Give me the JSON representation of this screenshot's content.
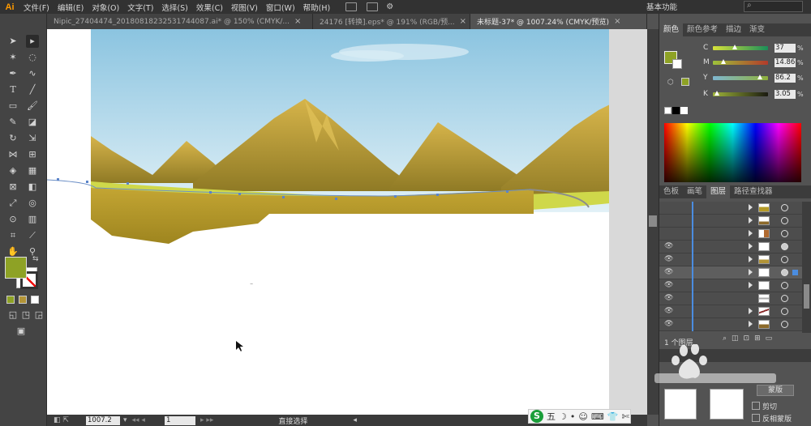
{
  "app": {
    "logo": "Ai"
  },
  "menu": [
    "文件(F)",
    "编辑(E)",
    "对象(O)",
    "文字(T)",
    "选择(S)",
    "效果(C)",
    "视图(V)",
    "窗口(W)",
    "帮助(H)"
  ],
  "workspace": "基本功能",
  "search": {
    "placeholder": ""
  },
  "tabs": [
    {
      "label": "Nipic_27404474_20180818232531744087.ai* @ 150% (CMYK/...",
      "close": "×",
      "active": false
    },
    {
      "label": "24176 [转换].eps* @ 191% (RGB/预...",
      "close": "×",
      "active": false
    },
    {
      "label": "未标题-37* @ 1007.24% (CMYK/预览)",
      "close": "×",
      "active": true
    }
  ],
  "status": {
    "zoom": "1007.2",
    "page": "1",
    "tool": "直接选择"
  },
  "color_panel": {
    "tabs": [
      "颜色",
      "颜色参考",
      "描边",
      "渐变"
    ],
    "channels": [
      {
        "label": "C",
        "value": "37",
        "pct": "%",
        "level": 0.37
      },
      {
        "label": "M",
        "value": "14.86",
        "pct": "%",
        "level": 0.1486
      },
      {
        "label": "Y",
        "value": "86.2",
        "pct": "%",
        "level": 0.862
      },
      {
        "label": "K",
        "value": "3.05",
        "pct": "%",
        "level": 0.0305
      }
    ],
    "fill": "#8ea225"
  },
  "layers_panel": {
    "tabs": [
      "色板",
      "画笔",
      "图层",
      "路径查找器"
    ],
    "count_label": "1 个图层"
  },
  "transparency": {
    "make_mask": "蒙版",
    "clip": "剪切",
    "invert": "反相蒙版"
  },
  "ime": {
    "mode": "五"
  },
  "colors": {
    "sky_top": "#8bc4e0",
    "sky_bottom": "#e2f1f7",
    "mountain": "#b29437",
    "ground": "#b59b28",
    "grass": "#c9d23c"
  }
}
